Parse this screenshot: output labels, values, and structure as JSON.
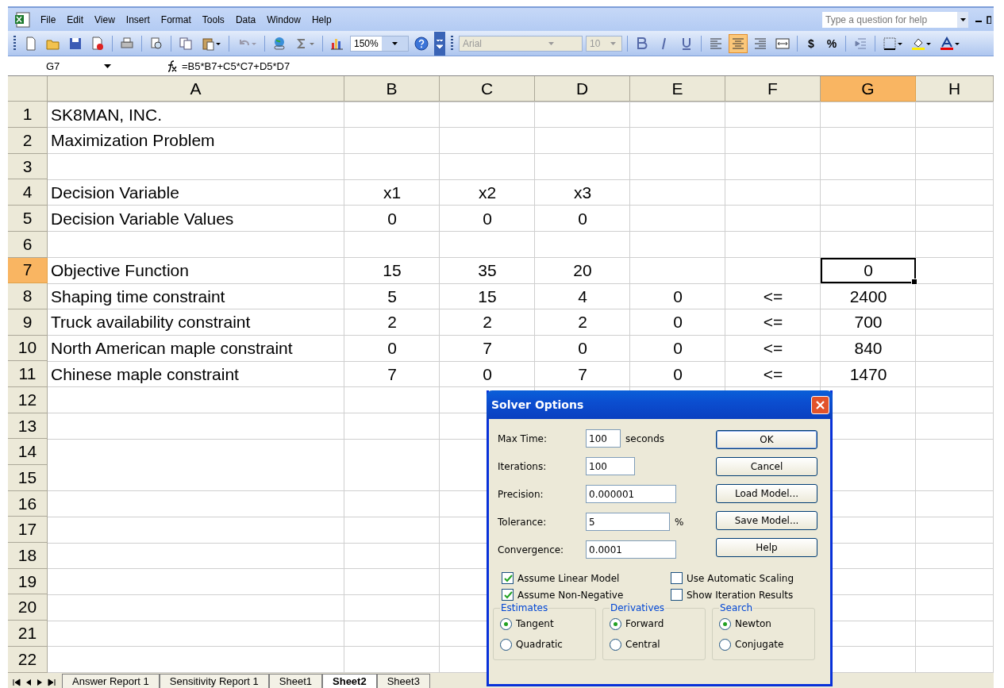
{
  "menu_bar": {
    "items": [
      "File",
      "Edit",
      "View",
      "Insert",
      "Format",
      "Tools",
      "Data",
      "Window",
      "Help"
    ],
    "help_box": {
      "placeholder": "Type a question for help"
    }
  },
  "toolbar": {
    "zoom": "150%",
    "font": "Arial",
    "font_size": "10",
    "align_buttons": [
      {
        "selected": false
      },
      {
        "selected": true
      },
      {
        "selected": false
      }
    ],
    "currency": "$",
    "percent": "%"
  },
  "formula_bar": {
    "name_box": "G7",
    "formula": "=B5*B7+C5*C7+D5*D7"
  },
  "sheet": {
    "columns": [
      {
        "label": "A",
        "selected": false
      },
      {
        "label": "B",
        "selected": false
      },
      {
        "label": "C",
        "selected": false
      },
      {
        "label": "D",
        "selected": false
      },
      {
        "label": "E",
        "selected": false
      },
      {
        "label": "F",
        "selected": false
      },
      {
        "label": "G",
        "selected": true
      },
      {
        "label": "H",
        "selected": false
      }
    ],
    "rows": [
      {
        "number": "1",
        "selected": false,
        "cells": [
          "SK8MAN, INC.",
          "",
          "",
          "",
          "",
          "",
          "",
          ""
        ]
      },
      {
        "number": "2",
        "selected": false,
        "cells": [
          "Maximization Problem",
          "",
          "",
          "",
          "",
          "",
          "",
          ""
        ]
      },
      {
        "number": "3",
        "selected": false,
        "cells": [
          "",
          "",
          "",
          "",
          "",
          "",
          "",
          ""
        ]
      },
      {
        "number": "4",
        "selected": false,
        "cells": [
          "Decision Variable",
          "x1",
          "x2",
          "x3",
          "",
          "",
          "",
          ""
        ]
      },
      {
        "number": "5",
        "selected": false,
        "cells": [
          "Decision Variable Values",
          "0",
          "0",
          "0",
          "",
          "",
          "",
          ""
        ]
      },
      {
        "number": "6",
        "selected": false,
        "cells": [
          "",
          "",
          "",
          "",
          "",
          "",
          "",
          ""
        ]
      },
      {
        "number": "7",
        "selected": true,
        "cells": [
          "Objective Function",
          "15",
          "35",
          "20",
          "",
          "",
          "0",
          ""
        ]
      },
      {
        "number": "8",
        "selected": false,
        "cells": [
          "Shaping time constraint",
          "5",
          "15",
          "4",
          "0",
          "<=",
          "2400",
          ""
        ]
      },
      {
        "number": "9",
        "selected": false,
        "cells": [
          "Truck availability constraint",
          "2",
          "2",
          "2",
          "0",
          "<=",
          "700",
          ""
        ]
      },
      {
        "number": "10",
        "selected": false,
        "cells": [
          "North American maple constraint",
          "0",
          "7",
          "0",
          "0",
          "<=",
          "840",
          ""
        ]
      },
      {
        "number": "11",
        "selected": false,
        "cells": [
          "Chinese maple constraint",
          "7",
          "0",
          "7",
          "0",
          "<=",
          "1470",
          ""
        ]
      },
      {
        "number": "12",
        "selected": false,
        "cells": [
          "",
          "",
          "",
          "",
          "",
          "",
          "",
          ""
        ]
      },
      {
        "number": "13",
        "selected": false,
        "cells": [
          "",
          "",
          "",
          "",
          "",
          "",
          "",
          ""
        ]
      },
      {
        "number": "14",
        "selected": false,
        "cells": [
          "",
          "",
          "",
          "",
          "",
          "",
          "",
          ""
        ]
      },
      {
        "number": "15",
        "selected": false,
        "cells": [
          "",
          "",
          "",
          "",
          "",
          "",
          "",
          ""
        ]
      },
      {
        "number": "16",
        "selected": false,
        "cells": [
          "",
          "",
          "",
          "",
          "",
          "",
          "",
          ""
        ]
      },
      {
        "number": "17",
        "selected": false,
        "cells": [
          "",
          "",
          "",
          "",
          "",
          "",
          "",
          ""
        ]
      },
      {
        "number": "18",
        "selected": false,
        "cells": [
          "",
          "",
          "",
          "",
          "",
          "",
          "",
          ""
        ]
      },
      {
        "number": "19",
        "selected": false,
        "cells": [
          "",
          "",
          "",
          "",
          "",
          "",
          "",
          ""
        ]
      },
      {
        "number": "20",
        "selected": false,
        "cells": [
          "",
          "",
          "",
          "",
          "",
          "",
          "",
          ""
        ]
      },
      {
        "number": "21",
        "selected": false,
        "cells": [
          "",
          "",
          "",
          "",
          "",
          "",
          "",
          ""
        ]
      },
      {
        "number": "22",
        "selected": false,
        "cells": [
          "",
          "",
          "",
          "",
          "",
          "",
          "",
          ""
        ]
      }
    ],
    "tabs": [
      {
        "label": "Answer Report 1",
        "selected": false
      },
      {
        "label": "Sensitivity Report 1",
        "selected": false
      },
      {
        "label": "Sheet1",
        "selected": false
      },
      {
        "label": "Sheet2",
        "selected": true
      },
      {
        "label": "Sheet3",
        "selected": false
      }
    ]
  },
  "dialog": {
    "title": "Solver Options",
    "fields": [
      {
        "label": "Max Time:",
        "value": "100",
        "unit": "seconds"
      },
      {
        "label": "Iterations:",
        "value": "100"
      },
      {
        "label": "Precision:",
        "value": "0.000001"
      },
      {
        "label": "Tolerance:",
        "value": "5",
        "unit": "%"
      },
      {
        "label": "Convergence:",
        "value": "0.0001"
      }
    ],
    "buttons": [
      "OK",
      "Cancel",
      "Load Model...",
      "Save Model...",
      "Help"
    ],
    "checkboxes": [
      {
        "label": "Assume Linear Model",
        "checked": true
      },
      {
        "label": "Use Automatic Scaling",
        "checked": false
      },
      {
        "label": "Assume Non-Negative",
        "checked": true
      },
      {
        "label": "Show Iteration Results",
        "checked": false
      }
    ],
    "groups": [
      {
        "title": "Estimates",
        "options": [
          {
            "label": "Tangent",
            "selected": true
          },
          {
            "label": "Quadratic",
            "selected": false
          }
        ]
      },
      {
        "title": "Derivatives",
        "options": [
          {
            "label": "Forward",
            "selected": true
          },
          {
            "label": "Central",
            "selected": false
          }
        ]
      },
      {
        "title": "Search",
        "options": [
          {
            "label": "Newton",
            "selected": true
          },
          {
            "label": "Conjugate",
            "selected": false
          }
        ]
      }
    ]
  }
}
